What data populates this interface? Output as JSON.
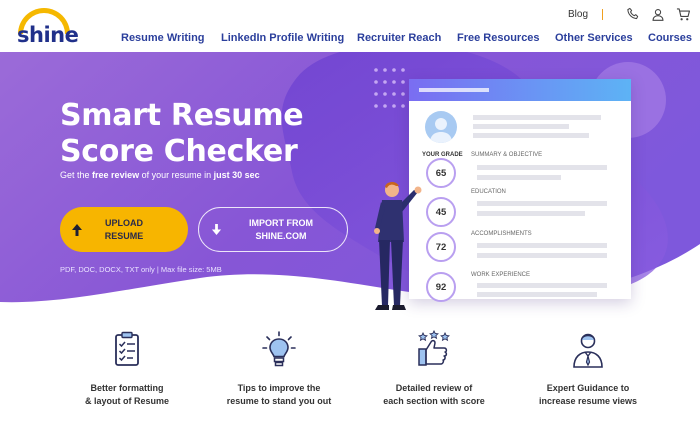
{
  "brand": {
    "logo_text": "shine"
  },
  "topbar": {
    "blog": "Blog"
  },
  "nav": [
    {
      "label": "Resume Writing"
    },
    {
      "label": "LinkedIn Profile Writing"
    },
    {
      "label": "Recruiter Reach"
    },
    {
      "label": "Free Resources"
    },
    {
      "label": "Other Services"
    },
    {
      "label": "Courses"
    }
  ],
  "hero": {
    "title_line1": "Smart Resume",
    "title_line2": "Score Checker",
    "subtitle_pre": "Get the",
    "subtitle_bold1": "free review",
    "subtitle_mid": "of your resume in",
    "subtitle_bold2": "just 30 sec",
    "upload_label": "UPLOAD RESUME",
    "import_label": "IMPORT FROM SHINE.COM",
    "file_note": "PDF, DOC, DOCX, TXT only | Max file size: 5MB"
  },
  "card": {
    "grade_label": "YOUR GRADE",
    "sections": [
      {
        "label": "SUMMARY & OBJECTIVE",
        "score": "65"
      },
      {
        "label": "EDUCATION",
        "score": "45"
      },
      {
        "label": "ACCOMPLISHMENTS",
        "score": "72"
      },
      {
        "label": "WORK EXPERIENCE",
        "score": "92"
      }
    ]
  },
  "features": [
    {
      "icon": "checklist-icon",
      "line1": "Better formatting",
      "line2": "& layout of Resume"
    },
    {
      "icon": "lightbulb-icon",
      "line1": "Tips to improve the",
      "line2": "resume to stand you out"
    },
    {
      "icon": "thumbs-up-stars-icon",
      "line1": "Detailed review of",
      "line2": "each section with score"
    },
    {
      "icon": "expert-person-icon",
      "line1": "Expert Guidance to",
      "line2": "increase resume views"
    }
  ],
  "colors": {
    "brand_blue": "#2b3f9c",
    "hero_purple": "#8a5ad8",
    "cta_yellow": "#f7b500",
    "logo_yellow": "#f5b800"
  }
}
